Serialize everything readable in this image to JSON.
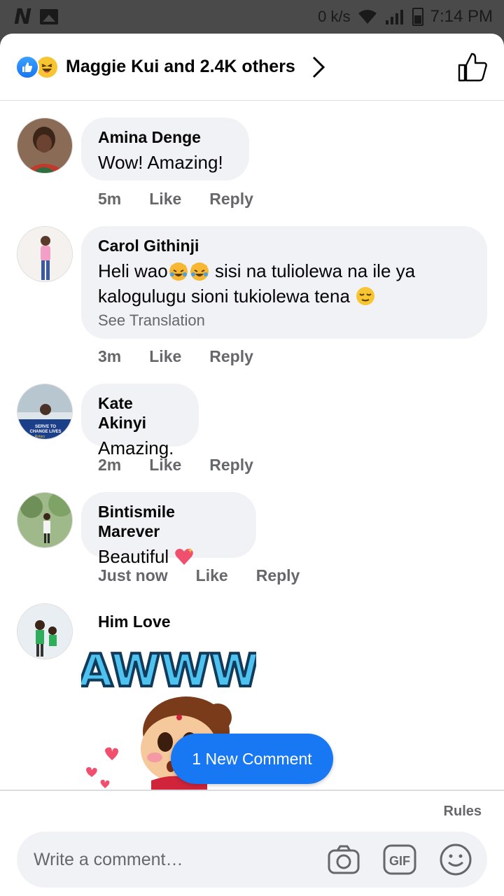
{
  "status_bar": {
    "speed": "0 k/s",
    "time": "7:14 PM"
  },
  "reactions": {
    "summary": "Maggie Kui and 2.4K others"
  },
  "comments": [
    {
      "name": "Amina Denge",
      "text": "Wow! Amazing!",
      "time": "5m",
      "like": "Like",
      "reply": "Reply"
    },
    {
      "name": "Carol Githinji",
      "text_line1": "Heli wao",
      "text_line1b": " sisi na tuliolewa na ile ya",
      "text_line2": "kalogulugu sioni tukiolewa tena ",
      "translate": "See Translation",
      "time": "3m",
      "like": "Like",
      "reply": "Reply"
    },
    {
      "name": "Kate Akinyi",
      "text": "Amazing.",
      "time": "2m",
      "like": "Like",
      "reply": "Reply"
    },
    {
      "name": "Bintismile Marever",
      "text": "Beautiful ",
      "time": "Just now",
      "like": "Like",
      "reply": "Reply"
    },
    {
      "name": "Him Love",
      "sticker_text": "AWWW"
    }
  ],
  "avatar_badge": {
    "line1": "SERVE TO",
    "line2": "CHANGE LIVES",
    "line3": "Rotary"
  },
  "new_comment_pill": "1 New Comment",
  "composer": {
    "rules": "Rules",
    "placeholder": "Write a comment…",
    "gif_label": "GIF"
  },
  "colors": {
    "accent": "#1877f2",
    "bubble": "#f0f2f5",
    "meta_text": "#65676b"
  }
}
